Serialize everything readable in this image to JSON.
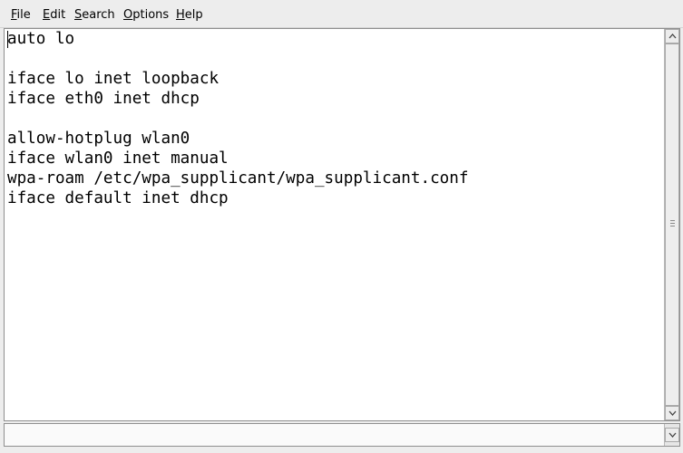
{
  "menu": {
    "items": [
      {
        "mnemonic": "F",
        "rest": "ile"
      },
      {
        "mnemonic": "E",
        "rest": "dit"
      },
      {
        "mnemonic": "S",
        "rest": "earch"
      },
      {
        "mnemonic": "O",
        "rest": "ptions"
      },
      {
        "mnemonic": "H",
        "rest": "elp"
      }
    ]
  },
  "editor": {
    "lines": [
      "auto lo",
      "",
      "iface lo inet loopback",
      "iface eth0 inet dhcp",
      "",
      "allow-hotplug wlan0",
      "iface wlan0 inet manual",
      "wpa-roam /etc/wpa_supplicant/wpa_supplicant.conf",
      "iface default inet dhcp"
    ]
  },
  "icons": {
    "scroll_up": "chevron-up-icon",
    "scroll_down": "chevron-down-icon"
  },
  "colors": {
    "background": "#ededed",
    "editor_bg": "#ffffff",
    "border": "#8f8f8f"
  }
}
